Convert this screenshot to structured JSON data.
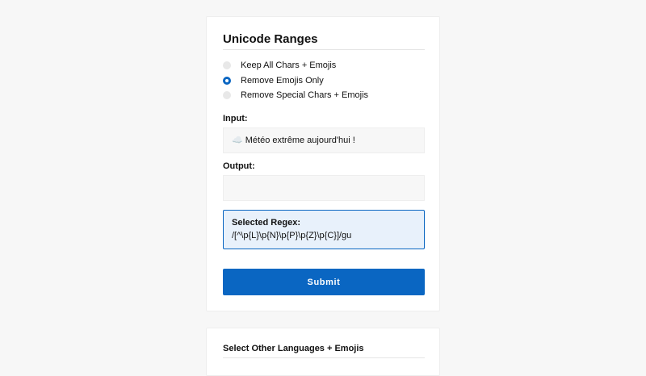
{
  "main_card": {
    "title": "Unicode Ranges",
    "options": [
      {
        "label": "Keep All Chars + Emojis",
        "checked": false
      },
      {
        "label": "Remove Emojis Only",
        "checked": true
      },
      {
        "label": "Remove Special Chars + Emojis",
        "checked": false
      }
    ],
    "input": {
      "label": "Input:",
      "value": "☁️ Météo extrême aujourd'hui !"
    },
    "output": {
      "label": "Output:",
      "value": ""
    },
    "regex": {
      "title": "Selected Regex:",
      "value": "/[^\\p{L}\\p{N}\\p{P}\\p{Z}\\p{C}]/gu"
    },
    "submit_label": "Submit"
  },
  "second_card": {
    "title": "Select Other Languages + Emojis"
  },
  "colors": {
    "accent": "#0a66c2",
    "regex_background": "#e8f1fb",
    "page_background": "#f7f7f7"
  }
}
